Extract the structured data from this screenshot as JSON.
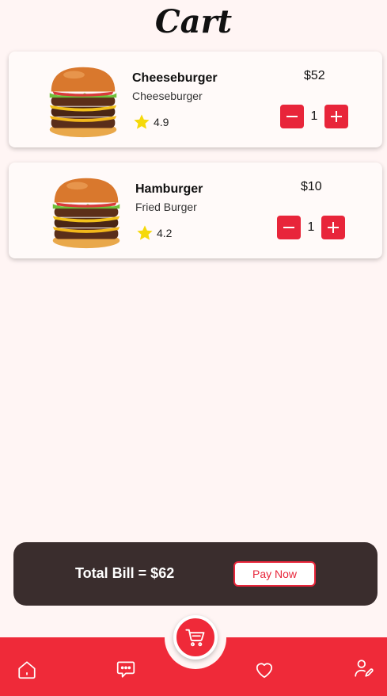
{
  "page": {
    "title": "Cart"
  },
  "cart": {
    "items": [
      {
        "name": "Cheeseburger",
        "subtitle": "Cheeseburger",
        "rating": "4.9",
        "price": "$52",
        "quantity": "1"
      },
      {
        "name": "Hamburger",
        "subtitle": "Fried Burger",
        "rating": "4.2",
        "price": "$10",
        "quantity": "1"
      }
    ]
  },
  "bill": {
    "total_label": "Total Bill = $62",
    "pay_label": "Pay Now"
  },
  "nav": {
    "items": [
      {
        "icon": "home-icon"
      },
      {
        "icon": "chat-icon"
      },
      {
        "icon": "cart-icon"
      },
      {
        "icon": "heart-icon"
      },
      {
        "icon": "profile-edit-icon"
      }
    ]
  },
  "colors": {
    "accent": "#ef2a39",
    "bill_bg": "#3a2d2d",
    "page_bg": "#fff5f4",
    "star": "#f5d90a"
  }
}
